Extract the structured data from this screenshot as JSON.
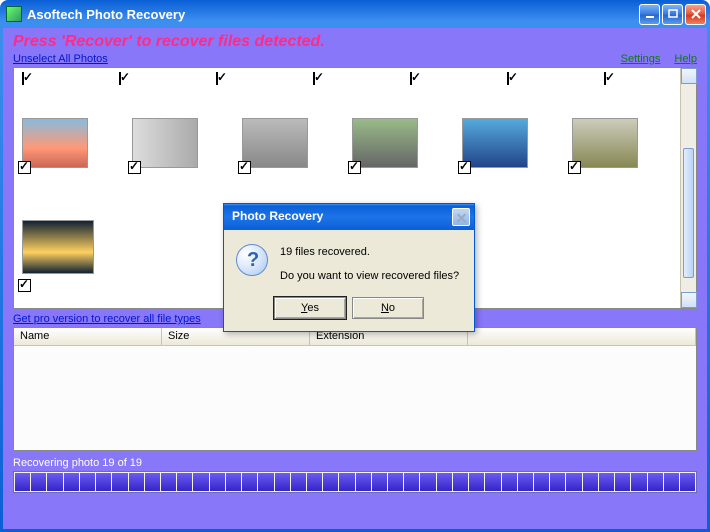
{
  "app": {
    "title": "Asoftech Photo Recovery"
  },
  "instruction": "Press 'Recover' to recover files detected.",
  "links": {
    "unselect": "Unselect All Photos",
    "settings": "Settings",
    "help": "Help",
    "pro": "Get pro version to recover all file types"
  },
  "table": {
    "cols": {
      "name": "Name",
      "size": "Size",
      "ext": "Extension"
    }
  },
  "status": "Recovering photo 19 of 19",
  "progress_segments": 42,
  "thumbs_top_count": 7,
  "dialog": {
    "title": "Photo Recovery",
    "line1": "19 files recovered.",
    "line2": "Do you want to view recovered files?",
    "yes_pre": "",
    "yes_u": "Y",
    "yes_post": "es",
    "no_pre": "",
    "no_u": "N",
    "no_post": "o"
  }
}
